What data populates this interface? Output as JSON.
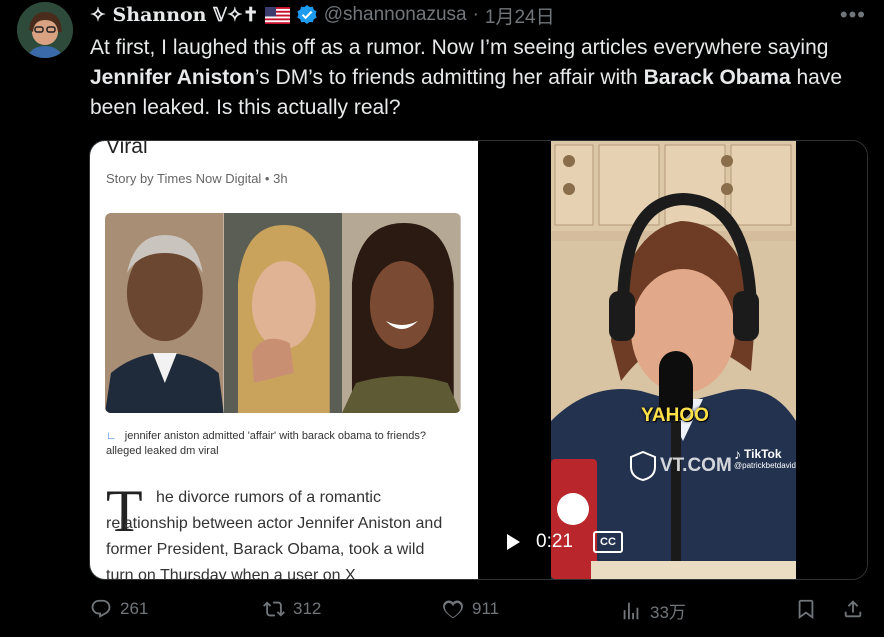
{
  "author": {
    "display_name": "✧ Shannon 𝕍✧✝",
    "handle": "@shannonazusa",
    "separator": "·",
    "date": "1月24日"
  },
  "tweet": {
    "part1": "At first, I laughed this off as a rumor. Now I’m seeing articles everywhere saying ",
    "bold1": "Jennifer Aniston",
    "part2": "’s DM’s to friends admitting her affair with ",
    "bold2": "Barack Obama",
    "part3": " have been leaked. Is this actually real?"
  },
  "article": {
    "heading": "Viral",
    "byline": "Story by Times Now Digital • 3h",
    "caption": "jennifer aniston admitted 'affair' with barack obama to friends? alleged leaked dm viral",
    "dropcap": "T",
    "paragraph": "he divorce rumors of a romantic relationship between actor Jennifer Aniston and former President, Barack Obama, took a wild turn on Thursday when a user on X"
  },
  "video": {
    "overlay_text": "YAHOO",
    "watermark": "VT.COM",
    "tiktok_label": "TikTok",
    "tiktok_handle": "@patrickbetdavid",
    "time": "0:21",
    "cc_label": "CC"
  },
  "actions": {
    "replies": "261",
    "reposts": "312",
    "likes": "911",
    "views": "33万"
  }
}
